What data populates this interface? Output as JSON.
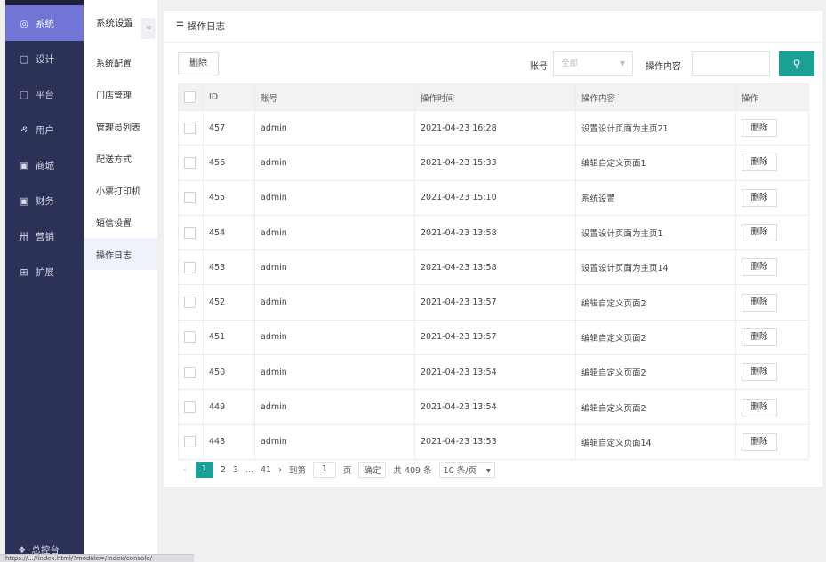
{
  "sidebar": {
    "items": [
      {
        "icon": "gear-icon",
        "glyph": "◎",
        "label": "系统",
        "active": true
      },
      {
        "icon": "design-icon",
        "glyph": "▢",
        "label": "设计",
        "active": false
      },
      {
        "icon": "platform-icon",
        "glyph": "▢",
        "label": "平台",
        "active": false
      },
      {
        "icon": "user-icon",
        "glyph": "ዳ",
        "label": "用户",
        "active": false
      },
      {
        "icon": "mall-icon",
        "glyph": "▣",
        "label": "商城",
        "active": false
      },
      {
        "icon": "finance-icon",
        "glyph": "▣",
        "label": "财务",
        "active": false
      },
      {
        "icon": "marketing-icon",
        "glyph": "卅",
        "label": "营销",
        "active": false
      },
      {
        "icon": "extend-icon",
        "glyph": "⊞",
        "label": "扩展",
        "active": false
      }
    ],
    "bottom_label": "总控台"
  },
  "submenu": {
    "title": "系统设置",
    "collapse": "«",
    "items": [
      {
        "label": "系统配置",
        "active": false
      },
      {
        "label": "门店管理",
        "active": false
      },
      {
        "label": "管理员列表",
        "active": false
      },
      {
        "label": "配送方式",
        "active": false
      },
      {
        "label": "小票打印机",
        "active": false
      },
      {
        "label": "短信设置",
        "active": false
      },
      {
        "label": "操作日志",
        "active": true
      }
    ]
  },
  "panel": {
    "title": "操作日志",
    "toolbar": {
      "delete_label": "删除",
      "account_label": "账号",
      "account_select": "全部",
      "content_label": "操作内容",
      "content_value": ""
    },
    "table": {
      "headers": [
        "ID",
        "账号",
        "操作时间",
        "操作内容",
        "操作"
      ],
      "row_action": "删除",
      "rows": [
        {
          "id": "457",
          "account": "admin",
          "time": "2021-04-23 16:28",
          "content": "设置设计页面为主页21"
        },
        {
          "id": "456",
          "account": "admin",
          "time": "2021-04-23 15:33",
          "content": "编辑自定义页面1"
        },
        {
          "id": "455",
          "account": "admin",
          "time": "2021-04-23 15:10",
          "content": "系统设置"
        },
        {
          "id": "454",
          "account": "admin",
          "time": "2021-04-23 13:58",
          "content": "设置设计页面为主页1"
        },
        {
          "id": "453",
          "account": "admin",
          "time": "2021-04-23 13:58",
          "content": "设置设计页面为主页14"
        },
        {
          "id": "452",
          "account": "admin",
          "time": "2021-04-23 13:57",
          "content": "编辑自定义页面2"
        },
        {
          "id": "451",
          "account": "admin",
          "time": "2021-04-23 13:57",
          "content": "编辑自定义页面2"
        },
        {
          "id": "450",
          "account": "admin",
          "time": "2021-04-23 13:54",
          "content": "编辑自定义页面2"
        },
        {
          "id": "449",
          "account": "admin",
          "time": "2021-04-23 13:54",
          "content": "编辑自定义页面2"
        },
        {
          "id": "448",
          "account": "admin",
          "time": "2021-04-23 13:53",
          "content": "编辑自定义页面14"
        }
      ]
    },
    "pager": {
      "prev": "‹",
      "pages": [
        "1",
        "2",
        "3",
        "...",
        "41"
      ],
      "current": "1",
      "next": "›",
      "goto_label": "到第",
      "goto_value": "1",
      "page_unit": "页",
      "confirm": "确定",
      "total": "共 409 条",
      "page_size": "10 条/页"
    }
  },
  "statusbar": {
    "text": "https://...//index.html/?module=/index/console/"
  },
  "colors": {
    "sidebar_bg": "#2c3158",
    "sidebar_active": "#7075d6",
    "accent": "#1aa094"
  }
}
